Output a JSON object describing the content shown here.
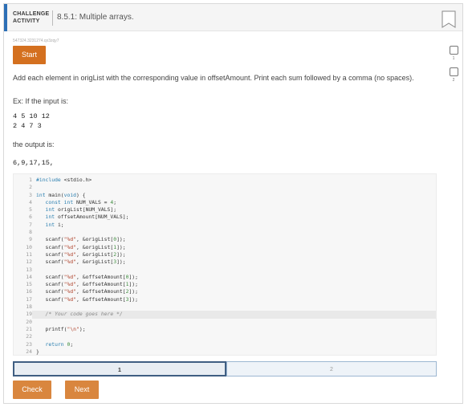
{
  "header": {
    "label_line1": "CHALLENGE",
    "label_line2": "ACTIVITY",
    "title": "8.5.1: Multiple arrays."
  },
  "side_steps": [
    "1",
    "2"
  ],
  "activity_id": "547324.3231274.qx3zqy7",
  "start_label": "Start",
  "prompt": "Add each element in origList with the corresponding value in offsetAmount. Print each sum followed by a comma (no spaces).",
  "example_label": "Ex: If the input is:",
  "example_input": [
    "4 5 10 12",
    "2 4 7 3"
  ],
  "output_label": "the output is:",
  "example_output": "6,9,17,15,",
  "code_lines": [
    "#include <stdio.h>",
    "",
    "int main(void) {",
    "   const int NUM_VALS = 4;",
    "   int origList[NUM_VALS];",
    "   int offsetAmount[NUM_VALS];",
    "   int i;",
    "",
    "   scanf(\"%d\", &origList[0]);",
    "   scanf(\"%d\", &origList[1]);",
    "   scanf(\"%d\", &origList[2]);",
    "   scanf(\"%d\", &origList[3]);",
    "",
    "   scanf(\"%d\", &offsetAmount[0]);",
    "   scanf(\"%d\", &offsetAmount[1]);",
    "   scanf(\"%d\", &offsetAmount[2]);",
    "   scanf(\"%d\", &offsetAmount[3]);",
    "",
    "   /* Your code goes here */",
    "",
    "   printf(\"\\n\");",
    "",
    "   return 0;",
    "}"
  ],
  "highlighted_line": 19,
  "steps": [
    "1",
    "2"
  ],
  "check_label": "Check",
  "next_label": "Next",
  "colors": {
    "accent": "#2d6fb6",
    "button": "#d4701f",
    "button_light": "#d9863e"
  }
}
